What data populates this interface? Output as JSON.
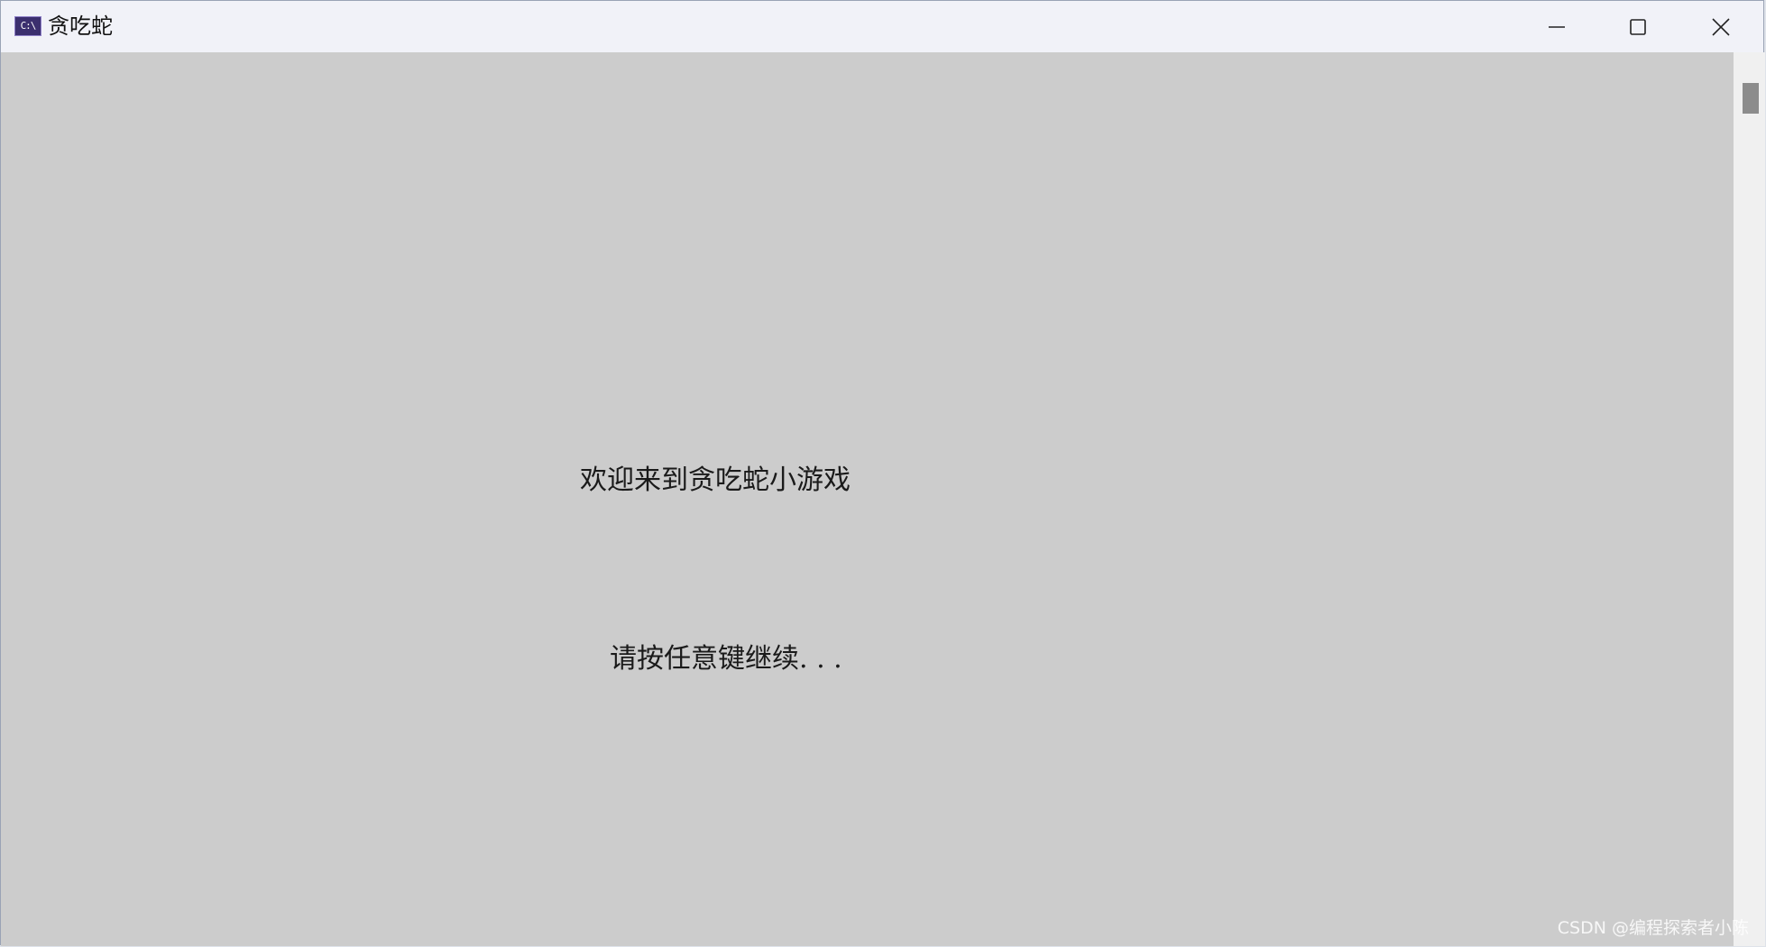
{
  "window": {
    "title": "贪吃蛇",
    "icon": "console-app-icon",
    "icon_text": "C:\\"
  },
  "title_controls": {
    "minimize_icon": "minimize-icon",
    "maximize_icon": "maximize-icon",
    "close_icon": "close-icon"
  },
  "console": {
    "welcome_text": "欢迎来到贪吃蛇小游戏",
    "prompt_text": "请按任意键继续. . ."
  },
  "watermark": "CSDN @编程探索者小陈",
  "colors": {
    "titlebar": "#f1f2f8",
    "console_background": "#cccccc",
    "text": "#1a1a1a"
  }
}
